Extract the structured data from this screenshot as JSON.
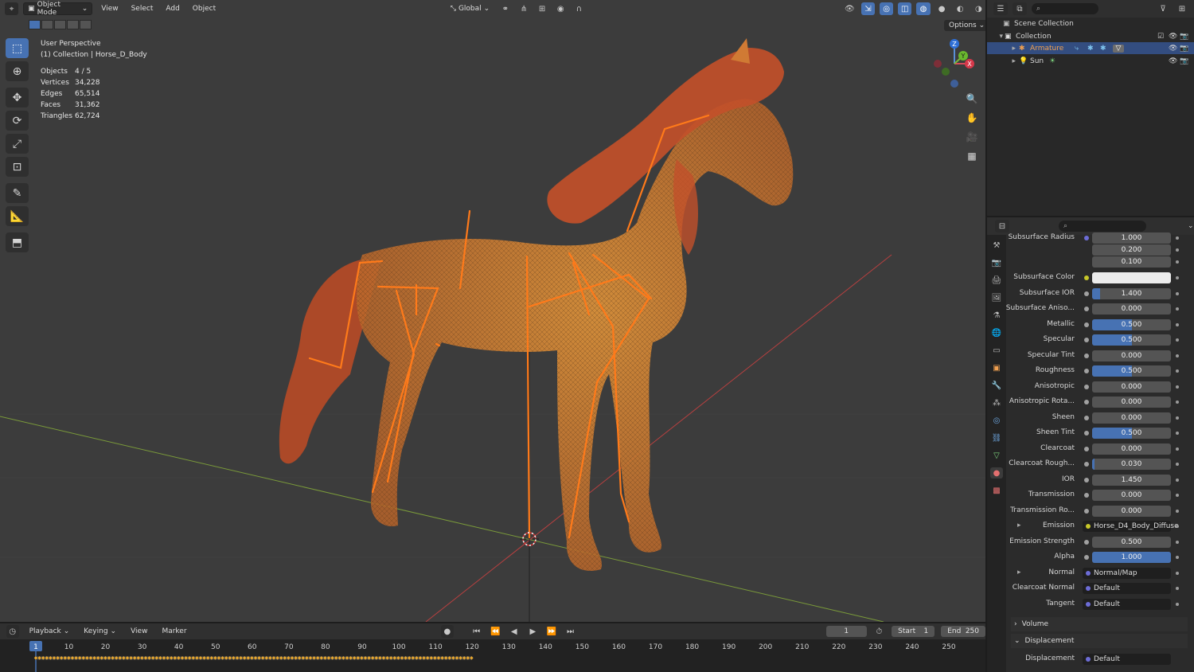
{
  "viewport": {
    "mode_label": "Object Mode",
    "menu": [
      "View",
      "Select",
      "Add",
      "Object"
    ],
    "transform_orientation": "Global",
    "options_label": "Options",
    "view_name": "User Perspective",
    "collection_path": "(1) Collection | Horse_D_Body",
    "stats": [
      {
        "key": "Objects",
        "value": "4 / 5"
      },
      {
        "key": "Vertices",
        "value": "34,228"
      },
      {
        "key": "Edges",
        "value": "65,514"
      },
      {
        "key": "Faces",
        "value": "31,362"
      },
      {
        "key": "Triangles",
        "value": "62,724"
      }
    ],
    "gizmo": {
      "z": "Z",
      "y": "Y",
      "x": "X"
    }
  },
  "outliner": {
    "items": [
      {
        "label": "Scene Collection"
      },
      {
        "label": "Collection"
      },
      {
        "label": "Armature"
      },
      {
        "label": "Sun"
      }
    ]
  },
  "properties": {
    "rows": [
      {
        "label": "Subsurface Radius",
        "value": "1.000",
        "fill": 0,
        "socket": "#6c6cd6"
      },
      {
        "label": "",
        "value": "0.200",
        "fill": 0,
        "socket": ""
      },
      {
        "label": "",
        "value": "0.100",
        "fill": 0,
        "socket": ""
      },
      {
        "label": "Subsurface Color",
        "value": "",
        "fill": 0,
        "socket": "#c7c729",
        "color": "#ececec"
      },
      {
        "label": "Subsurface IOR",
        "value": "1.400",
        "fill": 0.1,
        "socket": "#a1a1a1"
      },
      {
        "label": "Subsurface Aniso...",
        "value": "0.000",
        "fill": 0,
        "socket": "#a1a1a1"
      },
      {
        "label": "Metallic",
        "value": "0.500",
        "fill": 0.5,
        "socket": "#a1a1a1"
      },
      {
        "label": "Specular",
        "value": "0.500",
        "fill": 0.5,
        "socket": "#a1a1a1"
      },
      {
        "label": "Specular Tint",
        "value": "0.000",
        "fill": 0,
        "socket": "#a1a1a1"
      },
      {
        "label": "Roughness",
        "value": "0.500",
        "fill": 0.5,
        "socket": "#a1a1a1"
      },
      {
        "label": "Anisotropic",
        "value": "0.000",
        "fill": 0,
        "socket": "#a1a1a1"
      },
      {
        "label": "Anisotropic Rota...",
        "value": "0.000",
        "fill": 0,
        "socket": "#a1a1a1"
      },
      {
        "label": "Sheen",
        "value": "0.000",
        "fill": 0,
        "socket": "#a1a1a1"
      },
      {
        "label": "Sheen Tint",
        "value": "0.500",
        "fill": 0.5,
        "socket": "#a1a1a1"
      },
      {
        "label": "Clearcoat",
        "value": "0.000",
        "fill": 0,
        "socket": "#a1a1a1"
      },
      {
        "label": "Clearcoat Rough...",
        "value": "0.030",
        "fill": 0.03,
        "socket": "#a1a1a1"
      },
      {
        "label": "IOR",
        "value": "1.450",
        "fill": 0,
        "socket": "#a1a1a1"
      },
      {
        "label": "Transmission",
        "value": "0.000",
        "fill": 0,
        "socket": "#a1a1a1"
      },
      {
        "label": "Transmission Ro...",
        "value": "0.000",
        "fill": 0,
        "socket": "#a1a1a1"
      },
      {
        "label": "Emission",
        "value": "Horse_D4_Body_Diffuse",
        "link": true,
        "socket": "#c7c729"
      },
      {
        "label": "Emission Strength",
        "value": "0.500",
        "fill": 0,
        "socket": "#a1a1a1"
      },
      {
        "label": "Alpha",
        "value": "1.000",
        "fill": 1,
        "socket": "#a1a1a1"
      },
      {
        "label": "Normal",
        "value": "Normal/Map",
        "link": true,
        "socket": "#6c6cd6"
      },
      {
        "label": "Clearcoat Normal",
        "value": "Default",
        "link": true,
        "socket": "#6c6cd6"
      },
      {
        "label": "Tangent",
        "value": "Default",
        "link": true,
        "socket": "#6c6cd6"
      }
    ],
    "sections": {
      "volume": "Volume",
      "displacement": "Displacement"
    },
    "displacement_row": {
      "label": "Displacement",
      "value": "Default"
    }
  },
  "timeline": {
    "menu": [
      "Playback",
      "Keying",
      "View",
      "Marker"
    ],
    "current_frame": "1",
    "start_label": "Start",
    "start_value": "1",
    "end_label": "End",
    "end_value": "250",
    "ticks": [
      "1",
      "10",
      "20",
      "30",
      "40",
      "50",
      "60",
      "70",
      "80",
      "90",
      "100",
      "110",
      "120",
      "130",
      "140",
      "150",
      "160",
      "170",
      "180",
      "190",
      "200",
      "210",
      "220",
      "230",
      "240",
      "250"
    ],
    "keyframes_end": 120
  },
  "colors": {
    "accent": "#4772b3",
    "bone": "#ff7a1a",
    "wire": "#e07a2e",
    "selected_text": "#f0a050"
  }
}
